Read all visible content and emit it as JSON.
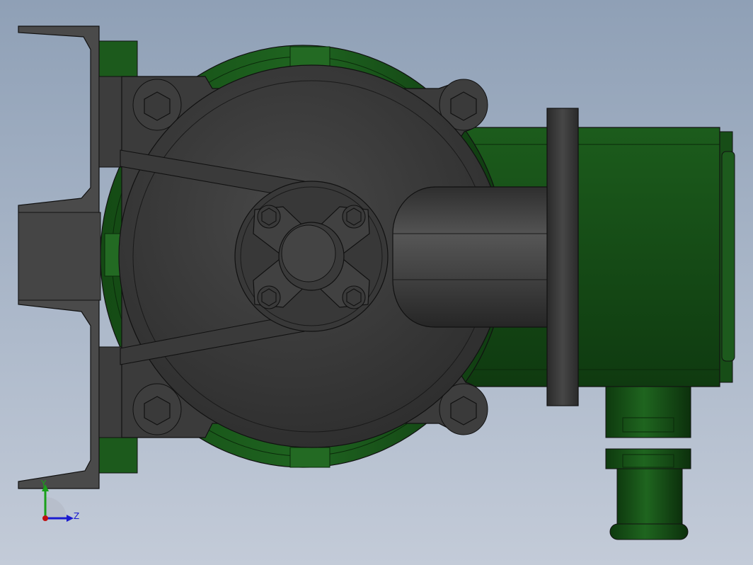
{
  "viewport": {
    "background_top": "#8fa0b6",
    "background_bottom": "#c3cbd8",
    "model": {
      "colors": {
        "dark_body": "#3a3a3a",
        "dark_body_light": "#4a4a4a",
        "bracket": "#4d4d4d",
        "green": "#1b5a1b",
        "green_dark": "#0f3a10",
        "edge": "#111111"
      }
    }
  },
  "triad": {
    "y_label": "Y",
    "z_label": "Z",
    "y_color": "#1aa01a",
    "z_color": "#1a1ad0",
    "x_color": "#c01010"
  }
}
